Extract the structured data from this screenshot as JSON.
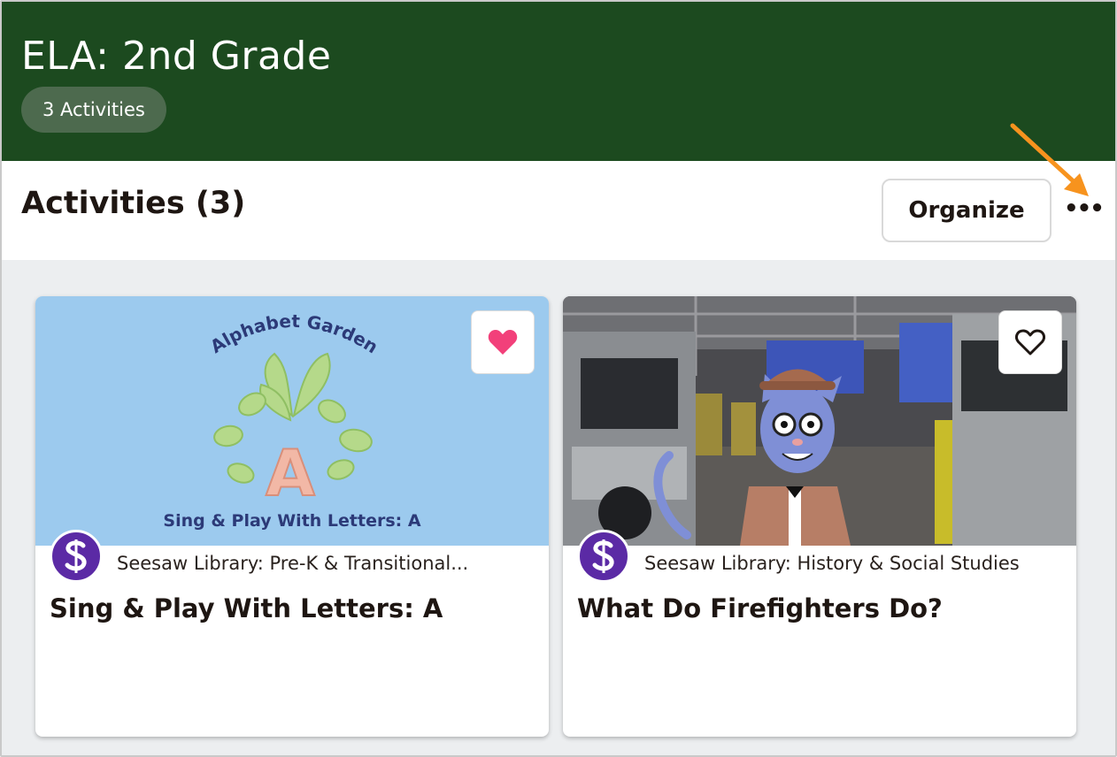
{
  "header": {
    "title": "ELA: 2nd Grade",
    "activity_count_badge": "3 Activities"
  },
  "toolbar": {
    "section_title": "Activities (3)",
    "organize_label": "Organize",
    "more_label": "•••"
  },
  "cards": [
    {
      "thumbnail_heading": "Alphabet Garden",
      "thumbnail_letter": "A",
      "thumbnail_caption": "Sing & Play With Letters: A",
      "source": "Seesaw Library: Pre-K & Transitional...",
      "title": "Sing & Play With Letters: A",
      "favorited": true
    },
    {
      "source": "Seesaw Library: History & Social Studies",
      "title": "What Do Firefighters Do?",
      "favorited": false
    }
  ],
  "colors": {
    "header_bg": "#1c4a1f",
    "badge_bg": "#4d6a4e",
    "heart_filled": "#f2407a",
    "seesaw_purple": "#5b2aa5",
    "annotation_arrow": "#f7931e"
  }
}
